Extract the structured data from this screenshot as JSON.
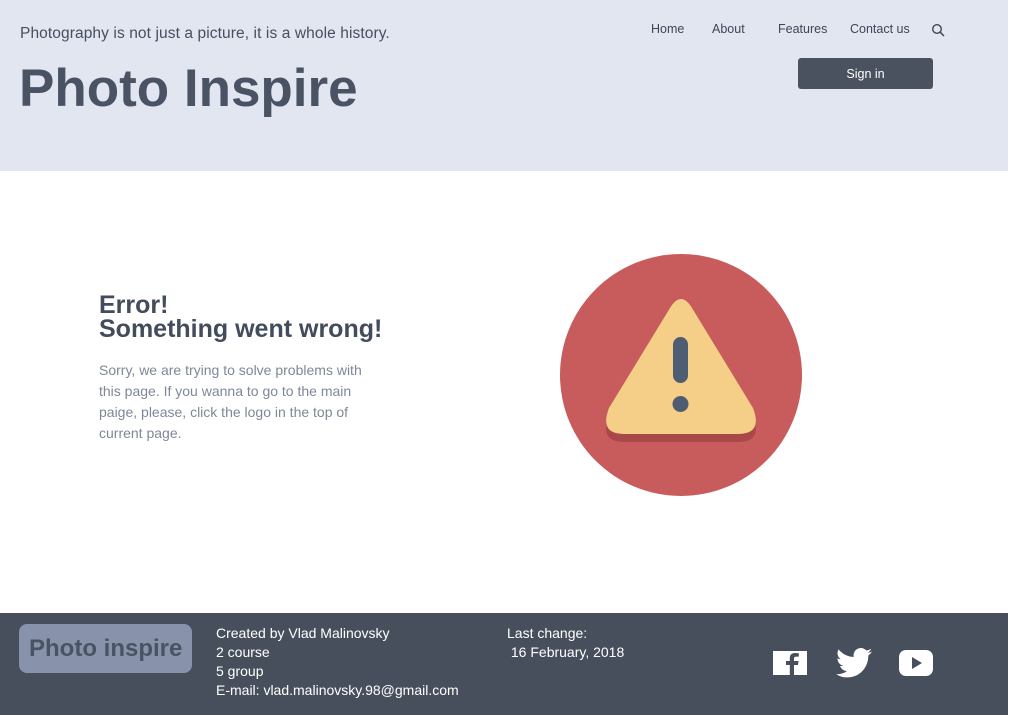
{
  "header": {
    "tagline": "Photography is not just a picture, it is a whole history.",
    "logo": "Photo Inspire",
    "nav": {
      "home": "Home",
      "about": "About",
      "features": "Features",
      "contact": "Contact us"
    },
    "search_icon": "search-icon",
    "signin_label": "Sign in"
  },
  "main": {
    "error_line1": "Error!",
    "error_line2": "Something went wrong!",
    "message": "Sorry, we are trying to solve problems with this page. If you wanna to go to the main paige, please, click the logo in the top of current page.",
    "graphic": "warning-triangle-icon",
    "colors": {
      "circle": "#c85c5c",
      "triangle": "#f5cf87",
      "mark": "#4f5d73"
    }
  },
  "footer": {
    "logo": "Photo inspire",
    "credits": {
      "author": "Created by Vlad Malinovsky",
      "course": "2 course",
      "group": "5 group",
      "email": "E-mail: vlad.malinovsky.98@gmail.com"
    },
    "last_change_label": "Last change:",
    "last_change_date": " 16 February, 2018",
    "social": [
      "facebook-icon",
      "twitter-icon",
      "youtube-icon"
    ]
  }
}
